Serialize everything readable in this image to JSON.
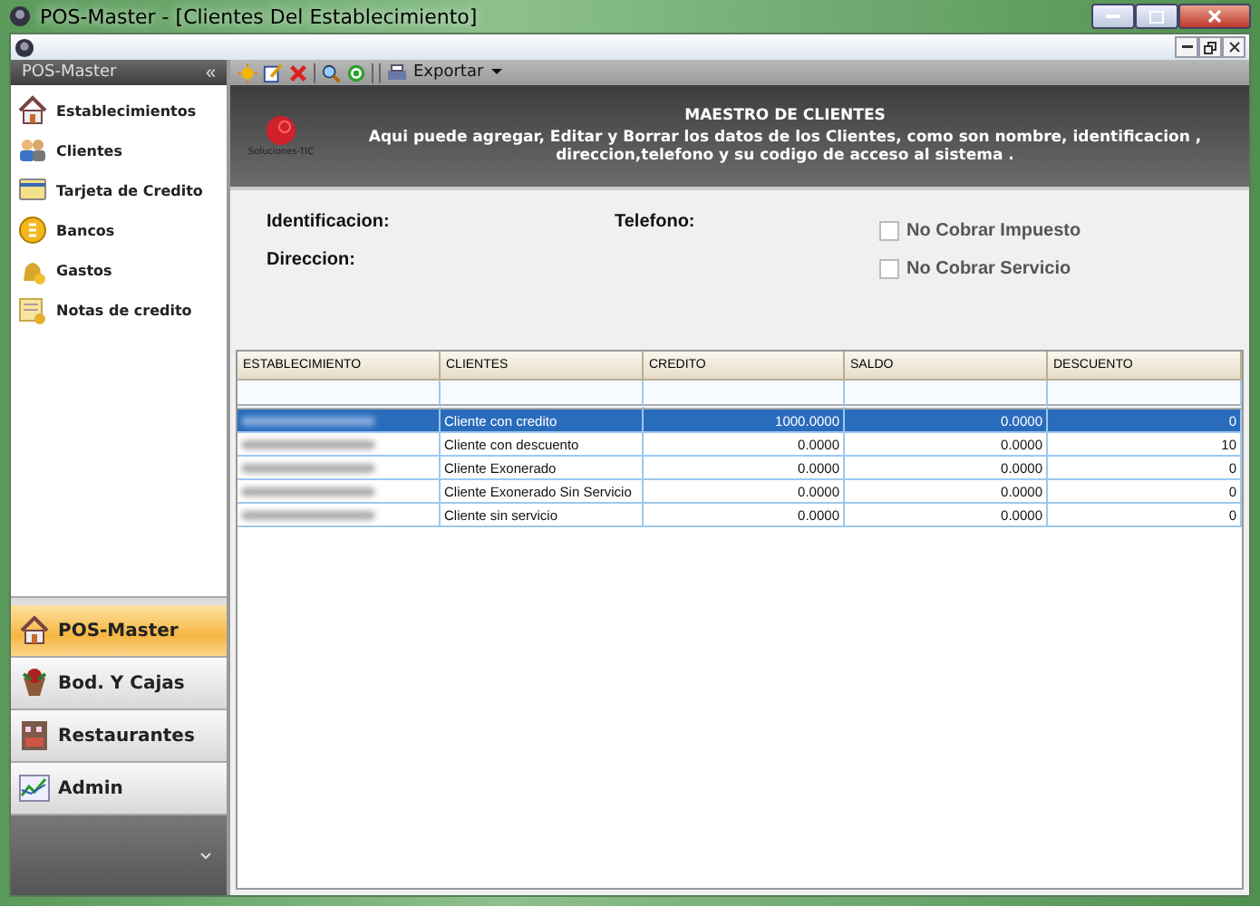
{
  "window": {
    "title": "POS-Master - [Clientes Del Establecimiento]"
  },
  "sidebar": {
    "title": "POS-Master",
    "collapse_glyph": "«",
    "items": [
      {
        "label": "Establecimientos"
      },
      {
        "label": "Clientes"
      },
      {
        "label": "Tarjeta de Credito"
      },
      {
        "label": "Bancos"
      },
      {
        "label": "Gastos"
      },
      {
        "label": "Notas de credito"
      }
    ],
    "modules": [
      {
        "label": "POS-Master",
        "selected": true
      },
      {
        "label": "Bod. Y Cajas",
        "selected": false
      },
      {
        "label": "Restaurantes",
        "selected": false
      },
      {
        "label": "Admin",
        "selected": false
      }
    ]
  },
  "toolbar": {
    "export_label": "Exportar"
  },
  "banner": {
    "logo_text": "Soluciones-TIC",
    "title": "MAESTRO DE CLIENTES",
    "description": "Aqui puede agregar, Editar y Borrar los datos de los Clientes, como son nombre, identificacion , direccion,telefono y su codigo de acceso al sistema ."
  },
  "form": {
    "labels": [
      "Identificacion:",
      "Telefono:",
      "Direccion:"
    ],
    "checks": [
      {
        "label": "No Cobrar Impuesto",
        "checked": false
      },
      {
        "label": "No Cobrar Servicio",
        "checked": false
      }
    ]
  },
  "table": {
    "columns": [
      "ESTABLECIMIENTO",
      "CLIENTES",
      "CREDITO",
      "SALDO",
      "DESCUENTO"
    ],
    "rows": [
      {
        "client": "Cliente con credito",
        "credit": "1000.0000",
        "balance": "0.0000",
        "discount": "0",
        "selected": true
      },
      {
        "client": "Cliente con descuento",
        "credit": "0.0000",
        "balance": "0.0000",
        "discount": "10",
        "selected": false
      },
      {
        "client": "Cliente Exonerado",
        "credit": "0.0000",
        "balance": "0.0000",
        "discount": "0",
        "selected": false
      },
      {
        "client": "Cliente Exonerado Sin Servicio",
        "credit": "0.0000",
        "balance": "0.0000",
        "discount": "0",
        "selected": false
      },
      {
        "client": "Cliente sin servicio",
        "credit": "0.0000",
        "balance": "0.0000",
        "discount": "0",
        "selected": false
      }
    ]
  }
}
